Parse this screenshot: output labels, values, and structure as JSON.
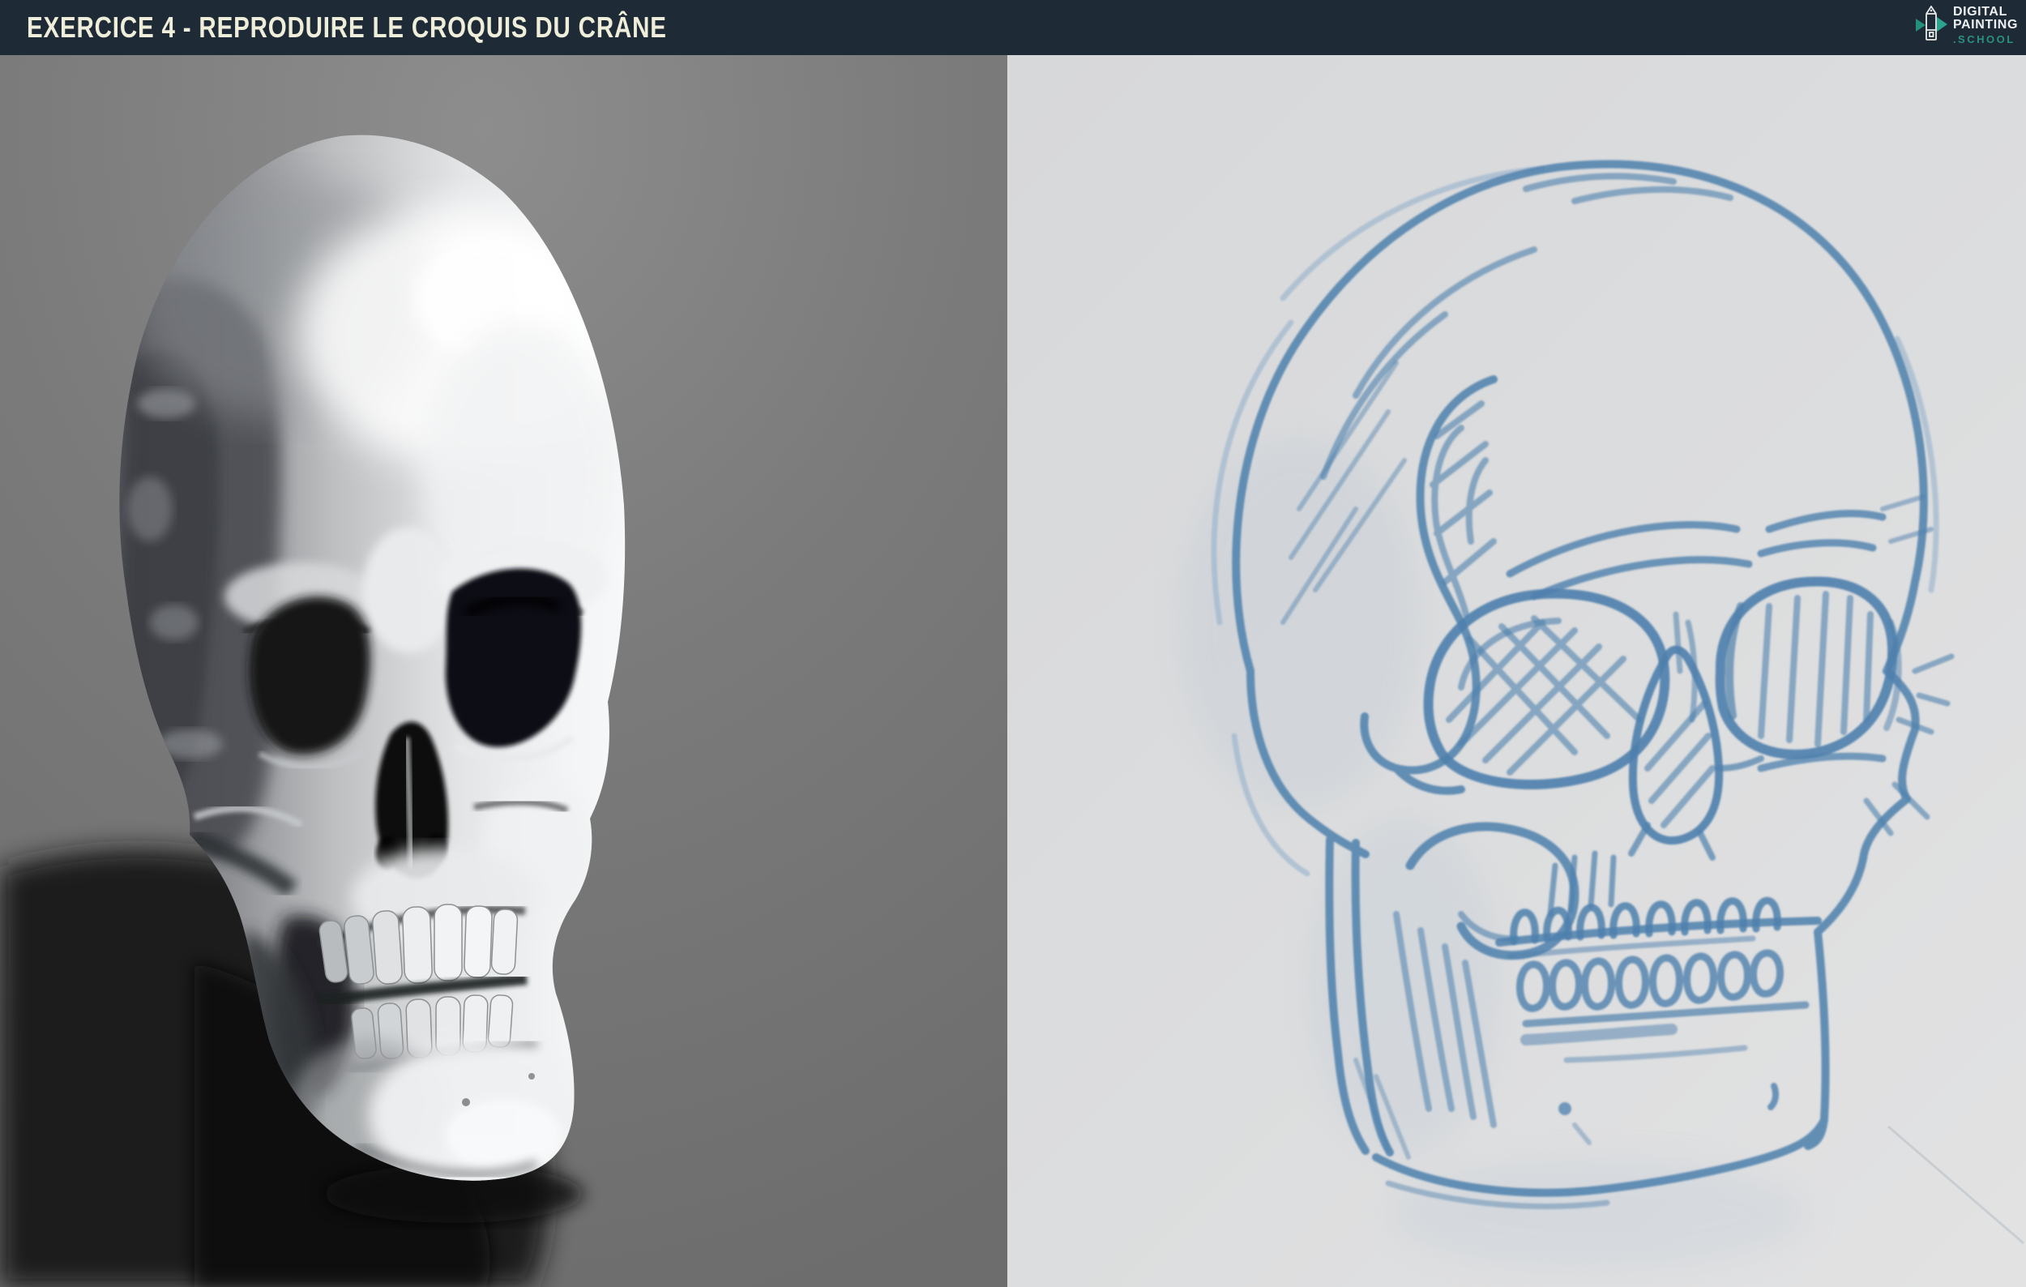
{
  "header": {
    "title": "EXERCICE 4 - REPRODUIRE LE CROQUIS DU CRÂNE"
  },
  "logo": {
    "line1": "DIGITAL",
    "line2": "PAINTING",
    "line3": ".SCHOOL"
  },
  "colors": {
    "header-bg": "#1f2a37",
    "title": "#efeeda",
    "logo-white": "#eef1f1",
    "accent-teal": "#2ba38f",
    "left-bg": "#7b7b7b",
    "right-bg": "#dcddde",
    "sketch-blue": "#4e80ad",
    "sketch-blue-faint": "#8fadca",
    "skull-highlight": "#f6f7f8",
    "cast-shadow": "#131416"
  }
}
